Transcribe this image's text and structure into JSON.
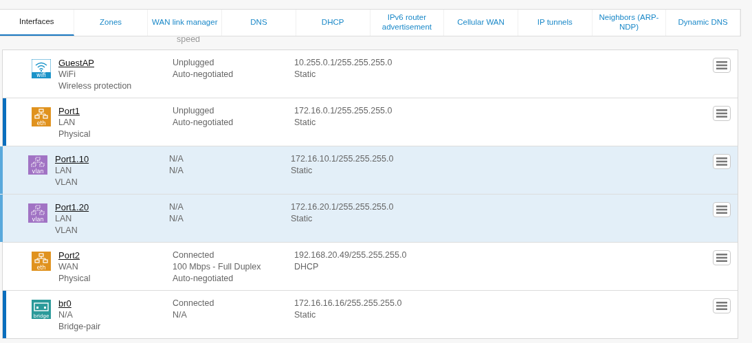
{
  "tabs": [
    {
      "label": "Interfaces",
      "selected": true
    },
    {
      "label": "Zones",
      "selected": false
    },
    {
      "label": "WAN link manager",
      "selected": false
    },
    {
      "label": "DNS",
      "selected": false
    },
    {
      "label": "DHCP",
      "selected": false
    },
    {
      "label": "IPv6 router advertisement",
      "selected": false
    },
    {
      "label": "Cellular WAN",
      "selected": false
    },
    {
      "label": "IP tunnels",
      "selected": false
    },
    {
      "label": "Neighbors (ARP-NDP)",
      "selected": false
    },
    {
      "label": "Dynamic DNS",
      "selected": false
    }
  ],
  "header_fragment": "speed",
  "rows": [
    {
      "kind": "wifi",
      "badge": "wifi",
      "name": "GuestAP",
      "zone": "WiFi",
      "type": "Wireless protection",
      "child": false,
      "expanded": false,
      "connection": [
        "Unplugged",
        "Auto-negotiated"
      ],
      "ip": [
        "10.255.0.1/255.255.255.0",
        "Static"
      ]
    },
    {
      "kind": "eth",
      "badge": "eth",
      "name": "Port1",
      "zone": "LAN",
      "type": "Physical",
      "child": false,
      "expanded": true,
      "connection": [
        "Unplugged",
        "Auto-negotiated"
      ],
      "ip": [
        "172.16.0.1/255.255.255.0",
        "Static"
      ]
    },
    {
      "kind": "vlan",
      "badge": "vlan",
      "name": "Port1.10",
      "zone": "LAN",
      "type": "VLAN",
      "child": true,
      "expanded": false,
      "connection": [
        "N/A",
        "N/A"
      ],
      "ip": [
        "172.16.10.1/255.255.255.0",
        "Static"
      ]
    },
    {
      "kind": "vlan",
      "badge": "vlan",
      "name": "Port1.20",
      "zone": "LAN",
      "type": "VLAN",
      "child": true,
      "expanded": false,
      "connection": [
        "N/A",
        "N/A"
      ],
      "ip": [
        "172.16.20.1/255.255.255.0",
        "Static"
      ]
    },
    {
      "kind": "eth",
      "badge": "eth",
      "name": "Port2",
      "zone": "WAN",
      "type": "Physical",
      "child": false,
      "expanded": false,
      "connection": [
        "Connected",
        "100 Mbps - Full Duplex",
        "Auto-negotiated"
      ],
      "ip": [
        "192.168.20.49/255.255.255.0",
        "DHCP"
      ]
    },
    {
      "kind": "bridge",
      "badge": "bridge",
      "name": "br0",
      "zone": "N/A",
      "type": "Bridge-pair",
      "child": false,
      "expanded": true,
      "connection": [
        "Connected",
        "N/A"
      ],
      "ip": [
        "172.16.16.16/255.255.255.0",
        "Static"
      ]
    }
  ]
}
